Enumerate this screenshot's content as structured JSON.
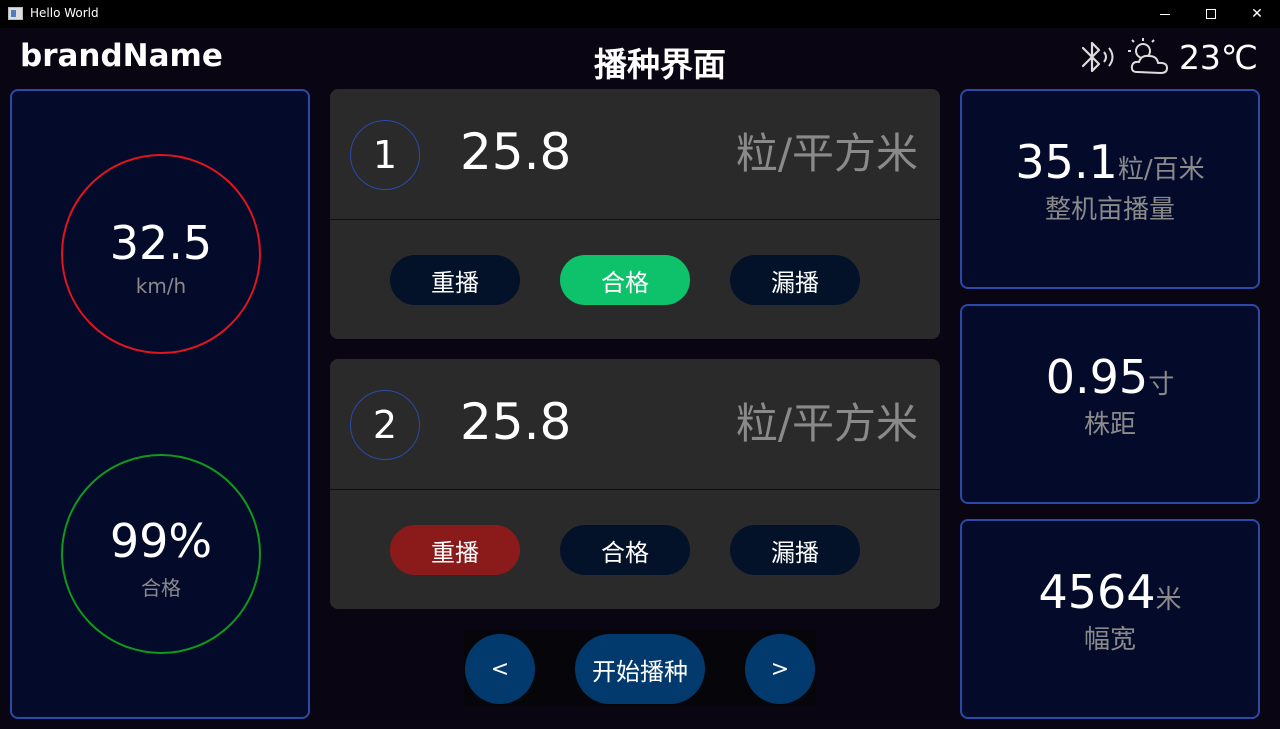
{
  "window": {
    "title": "Hello World"
  },
  "header": {
    "brand": "brandName",
    "title": "播种界面",
    "temperature": "23℃",
    "bluetooth_icon": "bluetooth-icon",
    "weather_icon": "partly-cloudy-icon"
  },
  "gauges": {
    "speed": {
      "value": "32.5",
      "unit": "km/h",
      "color": "#e0151e"
    },
    "pass_rate": {
      "value": "99%",
      "unit": "合格",
      "color": "#0f9a1a"
    }
  },
  "rows": [
    {
      "index": "1",
      "value": "25.8",
      "unit": "粒/平方米",
      "buttons": [
        "重播",
        "合格",
        "漏播"
      ],
      "active": "合格",
      "active_color": "#0dc26a"
    },
    {
      "index": "2",
      "value": "25.8",
      "unit": "粒/平方米",
      "buttons": [
        "重播",
        "合格",
        "漏播"
      ],
      "active": "重播",
      "active_color": "#8b1a1a"
    }
  ],
  "controls": {
    "prev": "<",
    "start": "开始播种",
    "next": ">"
  },
  "stats": [
    {
      "value": "35.1",
      "unit": "粒/百米",
      "label": "整机亩播量"
    },
    {
      "value": "0.95",
      "unit": "寸",
      "label": "株距"
    },
    {
      "value": "4564",
      "unit": "米",
      "label": "幅宽"
    }
  ],
  "colors": {
    "background": "#0a0512",
    "panel_bg": "#030a2a",
    "panel_border": "#2a4aa8",
    "card_bg": "#2a2a2a",
    "button_bg": "#033a6e",
    "muted_text": "#8a8a8a"
  }
}
